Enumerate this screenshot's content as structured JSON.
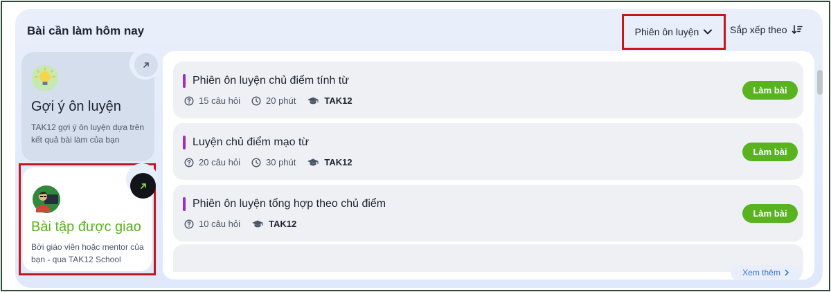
{
  "panel": {
    "title": "Bài cần làm hôm nay"
  },
  "filter": {
    "label": "Phiên ôn luyện",
    "icon": "chevron-down-icon"
  },
  "sort": {
    "label": "Sắp xếp theo",
    "icon": "sort-icon"
  },
  "suggest_card": {
    "title": "Gợi ý ôn luyện",
    "description": "TAK12 gợi ý ôn luyện dựa trên kết quả bài làm của bạn",
    "icon": "lightbulb-icon"
  },
  "assigned_card": {
    "title": "Bài tập được giao",
    "description": "Bởi giáo viên hoặc mentor của bạn - qua TAK12 School",
    "icon": "teacher-avatar-icon"
  },
  "items": [
    {
      "title": "Phiên ôn luyện chủ điểm tính từ",
      "questions": "15 câu hỏi",
      "duration": "20 phút",
      "org": "TAK12",
      "button": "Làm bài"
    },
    {
      "title": "Luyện chủ điểm mạo từ",
      "questions": "20 câu hỏi",
      "duration": "30 phút",
      "org": "TAK12",
      "button": "Làm bài"
    },
    {
      "title": "Phiên ôn luyện tổng hợp theo chủ điểm",
      "questions": "10 câu hỏi",
      "duration": "",
      "org": "TAK12",
      "button": "Làm bài"
    }
  ],
  "more": {
    "label": "Xem thêm"
  },
  "colors": {
    "accent_green": "#58b31f",
    "bar_purple": "#9a2fc8",
    "highlight_red": "#c8141b",
    "link_blue": "#3a76d4"
  }
}
